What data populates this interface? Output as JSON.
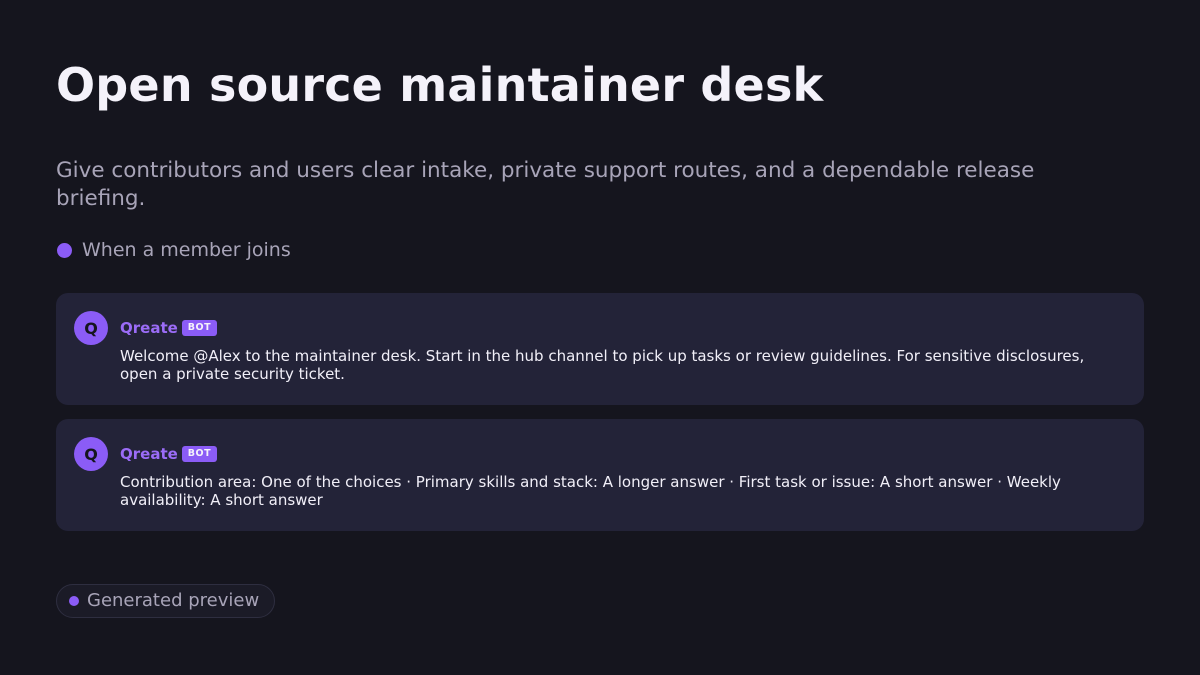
{
  "page": {
    "title": "Open source maintainer desk",
    "subtitle": "Give contributors and users clear intake, private support routes, and a dependable release briefing."
  },
  "trigger": {
    "label": "When a member joins",
    "dot_color": "#8b5cf6"
  },
  "messages": [
    {
      "avatar_letter": "Q",
      "author": "Qreate",
      "badge": "BOT",
      "body": "Welcome @Alex to the maintainer desk. Start in the hub channel to pick up tasks or review guidelines. For sensitive disclosures, open a private security ticket."
    },
    {
      "avatar_letter": "Q",
      "author": "Qreate",
      "badge": "BOT",
      "body": "Contribution area: One of the choices · Primary skills and stack: A longer answer · First task or issue: A short answer · Weekly availability: A short answer"
    }
  ],
  "status": {
    "label": "Generated preview"
  },
  "colors": {
    "background": "#15151e",
    "card": "#232338",
    "accent": "#8b5cf6",
    "muted_text": "#a8a4b8"
  },
  "icons": {
    "trigger": "dot",
    "status": "dot"
  }
}
